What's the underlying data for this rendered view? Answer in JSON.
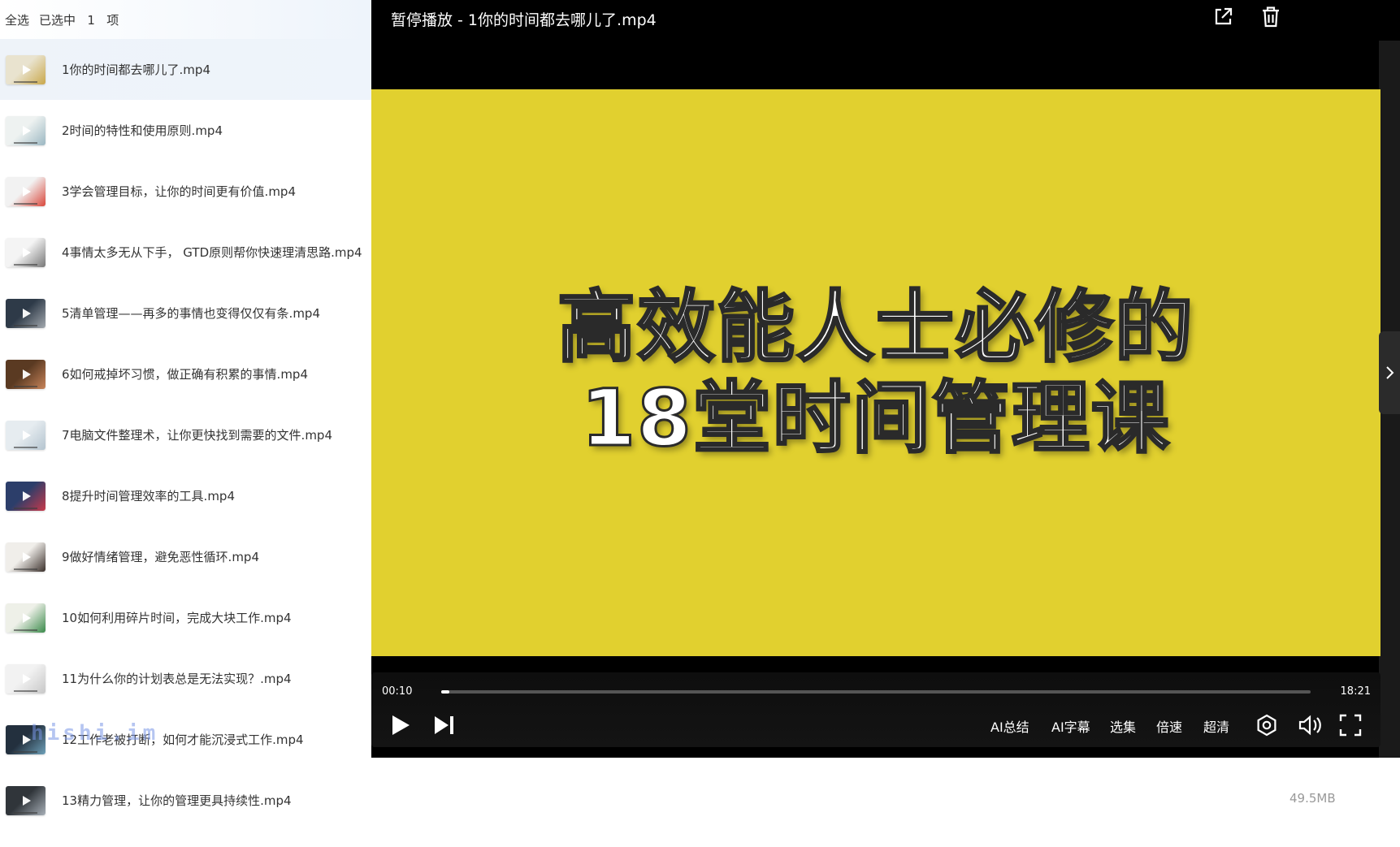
{
  "header": {
    "select_all": "全选",
    "selected_prefix": "已选中",
    "selected_count": "1",
    "selected_suffix": "项"
  },
  "files": [
    {
      "name": "1你的时间都去哪儿了.mp4",
      "selected": true,
      "thumb": [
        "#e9e3cf",
        "#c9a74a"
      ]
    },
    {
      "name": "2时间的特性和使用原则.mp4",
      "selected": false,
      "thumb": [
        "#eef2f1",
        "#9bb7c2"
      ]
    },
    {
      "name": "3学会管理目标，让你的时间更有价值.mp4",
      "selected": false,
      "thumb": [
        "#f2f2f2",
        "#d9473b"
      ]
    },
    {
      "name": "4事情太多无从下手， GTD原则帮你快速理清思路.mp4",
      "selected": false,
      "thumb": [
        "#f4f4f4",
        "#777777"
      ]
    },
    {
      "name": "5清单管理——再多的事情也变得仅仅有条.mp4",
      "selected": false,
      "thumb": [
        "#2e3a48",
        "#a3a9af"
      ]
    },
    {
      "name": "6如何戒掉坏习惯，做正确有积累的事情.mp4",
      "selected": false,
      "thumb": [
        "#5a3a22",
        "#c8845a"
      ]
    },
    {
      "name": "7电脑文件整理术，让你更快找到需要的文件.mp4",
      "selected": false,
      "thumb": [
        "#e6ecf0",
        "#b4c4cf"
      ]
    },
    {
      "name": "8提升时间管理效率的工具.mp4",
      "selected": false,
      "thumb": [
        "#2c3e6a",
        "#c9394a"
      ]
    },
    {
      "name": "9做好情绪管理，避免恶性循环.mp4",
      "selected": false,
      "thumb": [
        "#f0eeea",
        "#3a2f2a"
      ]
    },
    {
      "name": "10如何利用碎片时间，完成大块工作.mp4",
      "selected": false,
      "thumb": [
        "#eef0e8",
        "#3a8a4a"
      ]
    },
    {
      "name": "11为什么你的计划表总是无法实现？.mp4",
      "selected": false,
      "thumb": [
        "#f2f2f2",
        "#c7c7c7"
      ]
    },
    {
      "name": "12工作老被打断，如何才能沉浸式工作.mp4",
      "selected": false,
      "thumb": [
        "#23303e",
        "#6fa1b9"
      ]
    },
    {
      "name": "13精力管理，让你的管理更具持续性.mp4",
      "selected": false,
      "thumb": [
        "#30353a",
        "#a8b0b8"
      ]
    }
  ],
  "watermark": "hishi.im",
  "player": {
    "title": "暂停播放 - 1你的时间都去哪儿了.mp4",
    "video_line1": "高效能人士必修的",
    "video_line2": "18堂时间管理课",
    "video_bg": "#e1d02f",
    "current_time": "00:10",
    "total_time": "18:21",
    "progress": 0.009,
    "menu": {
      "ai_summary": "AI总结",
      "ai_subtitle": "AI字幕",
      "episodes": "选集",
      "speed": "倍速",
      "quality": "超清"
    }
  },
  "file_size": "49.5MB"
}
